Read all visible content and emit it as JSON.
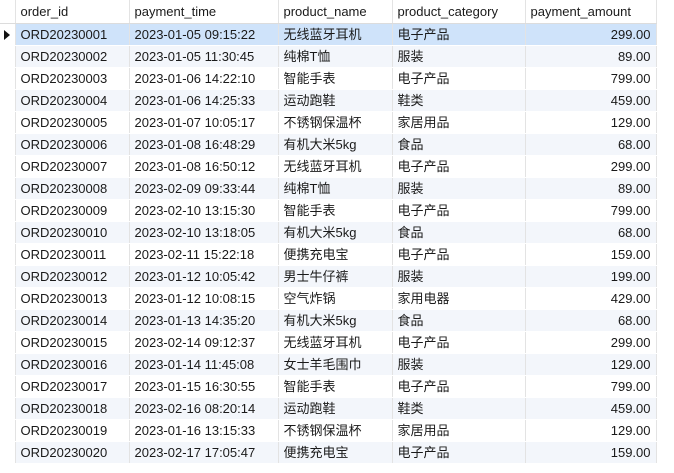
{
  "columns": [
    "order_id",
    "payment_time",
    "product_name",
    "product_category",
    "payment_amount"
  ],
  "rows": [
    [
      "ORD20230001",
      "2023-01-05 09:15:22",
      "无线蓝牙耳机",
      "电子产品",
      "299.00"
    ],
    [
      "ORD20230002",
      "2023-01-05 11:30:45",
      "纯棉T恤",
      "服装",
      "89.00"
    ],
    [
      "ORD20230003",
      "2023-01-06 14:22:10",
      "智能手表",
      "电子产品",
      "799.00"
    ],
    [
      "ORD20230004",
      "2023-01-06 14:25:33",
      "运动跑鞋",
      "鞋类",
      "459.00"
    ],
    [
      "ORD20230005",
      "2023-01-07 10:05:17",
      "不锈钢保温杯",
      "家居用品",
      "129.00"
    ],
    [
      "ORD20230006",
      "2023-01-08 16:48:29",
      "有机大米5kg",
      "食品",
      "68.00"
    ],
    [
      "ORD20230007",
      "2023-01-08 16:50:12",
      "无线蓝牙耳机",
      "电子产品",
      "299.00"
    ],
    [
      "ORD20230008",
      "2023-02-09 09:33:44",
      "纯棉T恤",
      "服装",
      "89.00"
    ],
    [
      "ORD20230009",
      "2023-02-10 13:15:30",
      "智能手表",
      "电子产品",
      "799.00"
    ],
    [
      "ORD20230010",
      "2023-02-10 13:18:05",
      "有机大米5kg",
      "食品",
      "68.00"
    ],
    [
      "ORD20230011",
      "2023-02-11 15:22:18",
      "便携充电宝",
      "电子产品",
      "159.00"
    ],
    [
      "ORD20230012",
      "2023-01-12 10:05:42",
      "男士牛仔裤",
      "服装",
      "199.00"
    ],
    [
      "ORD20230013",
      "2023-01-12 10:08:15",
      "空气炸锅",
      "家用电器",
      "429.00"
    ],
    [
      "ORD20230014",
      "2023-01-13 14:35:20",
      "有机大米5kg",
      "食品",
      "68.00"
    ],
    [
      "ORD20230015",
      "2023-02-14 09:12:37",
      "无线蓝牙耳机",
      "电子产品",
      "299.00"
    ],
    [
      "ORD20230016",
      "2023-01-14 11:45:08",
      "女士羊毛围巾",
      "服装",
      "129.00"
    ],
    [
      "ORD20230017",
      "2023-01-15 16:30:55",
      "智能手表",
      "电子产品",
      "799.00"
    ],
    [
      "ORD20230018",
      "2023-02-16 08:20:14",
      "运动跑鞋",
      "鞋类",
      "459.00"
    ],
    [
      "ORD20230019",
      "2023-01-16 13:15:33",
      "不锈钢保温杯",
      "家居用品",
      "129.00"
    ],
    [
      "ORD20230020",
      "2023-02-17 17:05:47",
      "便携充电宝",
      "电子产品",
      "159.00"
    ]
  ],
  "selected_row": 0,
  "colors": {
    "selected": "#cfe3fa",
    "stripe": "#f3f6fb",
    "border": "#e3e3e3"
  }
}
